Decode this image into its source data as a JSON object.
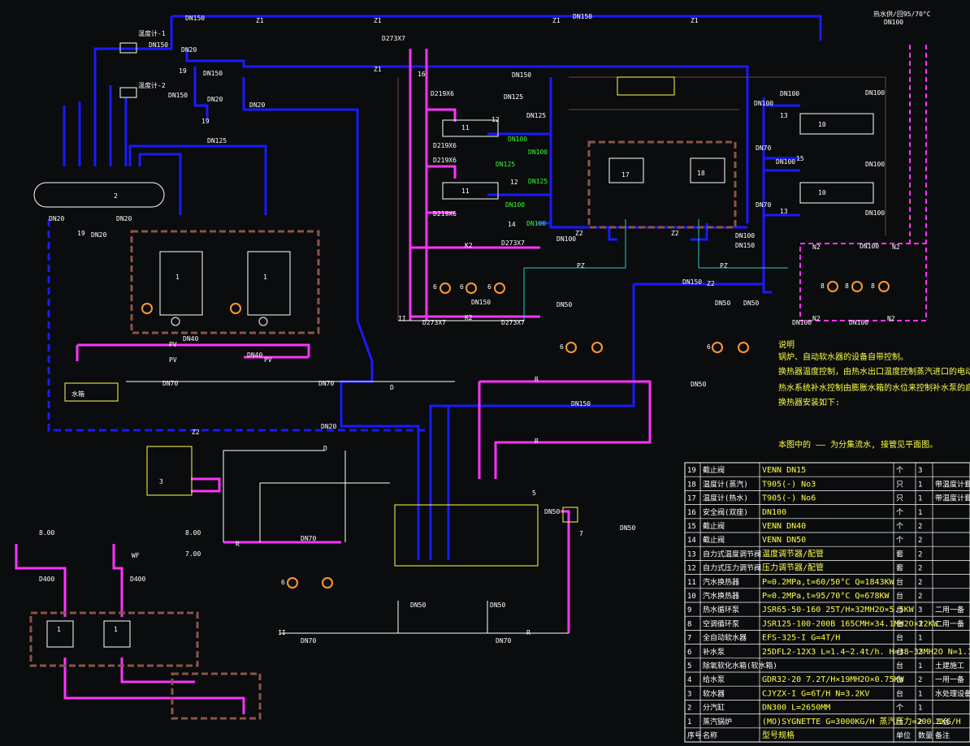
{
  "pipe_labels": {
    "dn150": "DN150",
    "dn125": "DN125",
    "dn100": "DN100",
    "dn70": "DN70",
    "dn50": "DN50",
    "dn40": "DN40",
    "dn32": "DN32",
    "dn25": "DN25",
    "dn20": "DN20",
    "dn400": "D400",
    "d273": "D273X7",
    "d219": "D219X6",
    "z1": "Z1",
    "z2": "Z2",
    "n1": "N1",
    "n2": "N2",
    "k1": "K1",
    "k2": "K2",
    "pz": "PZ",
    "pv": "PV",
    "r": "R",
    "d": "D",
    "ii": "II",
    "wf": "WF"
  },
  "levels": {
    "l1": "8.00",
    "l2": "8.00",
    "l3": "7.00"
  },
  "supply_note": "热水供/回95/70°C",
  "equipment_numbers": [
    "1",
    "2",
    "3",
    "5",
    "6",
    "7",
    "8",
    "9",
    "10",
    "11",
    "12",
    "13",
    "14",
    "15",
    "16",
    "17",
    "18",
    "19"
  ],
  "tags": {
    "tag1": "温度计-1",
    "tag2": "温度计-2",
    "tank": "水箱"
  },
  "notes": {
    "title": "说明",
    "lines": [
      "锅炉、自动软水器的设备自带控制。",
      "换热器温度控制，由热水出口温度控制蒸汽进口的电动调节阀开度。",
      "热水系统补水控制由膨胀水箱的水位来控制补水泵的启,停",
      "换热器安装如下:"
    ],
    "legend_line": "本图中的 —— 为分集流水, 接管见平面图。"
  },
  "table": {
    "rows": [
      {
        "no": "19",
        "name": "截止阀",
        "spec": "VENN DN15",
        "unit": "个",
        "qty": "3",
        "remark": ""
      },
      {
        "no": "18",
        "name": "温度计(蒸汽)",
        "spec": "T905(-) No3",
        "unit": "只",
        "qty": "1",
        "remark": "带温度计套"
      },
      {
        "no": "17",
        "name": "温度计(热水)",
        "spec": "T905(-) No6",
        "unit": "只",
        "qty": "1",
        "remark": "带温度计套"
      },
      {
        "no": "16",
        "name": "安全阀(双座)",
        "spec": "DN100",
        "unit": "个",
        "qty": "1",
        "remark": ""
      },
      {
        "no": "15",
        "name": "截止阀",
        "spec": "VENN DN40",
        "unit": "个",
        "qty": "2",
        "remark": ""
      },
      {
        "no": "14",
        "name": "截止阀",
        "spec": "VENN DN50",
        "unit": "个",
        "qty": "2",
        "remark": ""
      },
      {
        "no": "13",
        "name": "自力式温度调节阀",
        "spec": "温度调节器/配管",
        "unit": "套",
        "qty": "2",
        "remark": ""
      },
      {
        "no": "12",
        "name": "自力式压力调节阀",
        "spec": "压力调节器/配管",
        "unit": "套",
        "qty": "2",
        "remark": ""
      },
      {
        "no": "11",
        "name": "汽水换热器",
        "spec": "P=0.2MPa,t=60/50°C Q=1843KW",
        "unit": "台",
        "qty": "2",
        "remark": ""
      },
      {
        "no": "10",
        "name": "汽水换热器",
        "spec": "P=0.2MPa,t=95/70°C Q=678KW",
        "unit": "台",
        "qty": "2",
        "remark": ""
      },
      {
        "no": "9",
        "name": "热水循环泵",
        "spec": "JSR65-50-160 25T/H×32MH2O×5.5KW",
        "unit": "台",
        "qty": "3",
        "remark": "二用一备"
      },
      {
        "no": "8",
        "name": "空调循环泵",
        "spec": "JSR125-100-200B 165CMH×34.1MH2O×22KW",
        "unit": "台",
        "qty": "3",
        "remark": "二用一备"
      },
      {
        "no": "7",
        "name": "全自动软水器",
        "spec": "EFS-325-I G=4T/H",
        "unit": "台",
        "qty": "1",
        "remark": ""
      },
      {
        "no": "6",
        "name": "补水泵",
        "spec": "25DFL2-12X3 L=1.4~2.4t/h. H=38~33MH2O N=1.1KW",
        "unit": "台",
        "qty": "2",
        "remark": ""
      },
      {
        "no": "5",
        "name": "除氧软化水箱(软水箱)",
        "spec": "",
        "unit": "台",
        "qty": "1",
        "remark": "土建施工"
      },
      {
        "no": "4",
        "name": "给水泵",
        "spec": "GDR32-20 7.2T/H×19MH2O×0.75KW",
        "unit": "台",
        "qty": "2",
        "remark": "一用一备"
      },
      {
        "no": "3",
        "name": "软水器",
        "spec": "CJYZX-I G=6T/H  N=3.2KV",
        "unit": "台",
        "qty": "1",
        "remark": "水处理设备"
      },
      {
        "no": "2",
        "name": "分汽缸",
        "spec": "DN300 L=2650MM",
        "unit": "个",
        "qty": "1",
        "remark": ""
      },
      {
        "no": "1",
        "name": "蒸汽锅炉",
        "spec": "(MO)SYGNETTE G=3000KG/H 蒸汽压力=200.8KG/H",
        "unit": "台",
        "qty": "2",
        "remark": "二台"
      }
    ],
    "header": [
      "序号",
      "名称",
      "型号规格",
      "单位",
      "数量",
      "备注"
    ]
  },
  "colors": {
    "steam": "#1a1aff",
    "hot_water": "#ff33ff",
    "equip": "#ffffff",
    "label": "#ffff44",
    "code": "#33ff33",
    "cyan": "#22cccc",
    "frame": "#8a5548"
  }
}
